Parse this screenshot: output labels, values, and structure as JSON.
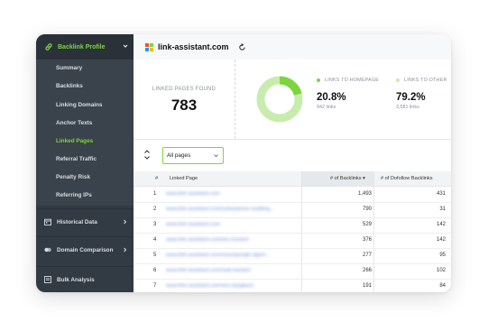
{
  "app": {
    "domain": "link-assistant.com"
  },
  "sidebar": {
    "header": {
      "label": "Backlink Profile"
    },
    "sub_items": [
      {
        "label": "Summary",
        "active": false
      },
      {
        "label": "Backlinks",
        "active": false
      },
      {
        "label": "Linking Domains",
        "active": false
      },
      {
        "label": "Anchor Texts",
        "active": false
      },
      {
        "label": "Linked Pages",
        "active": true
      },
      {
        "label": "Referral Traffic",
        "active": false
      },
      {
        "label": "Penalty Risk",
        "active": false
      },
      {
        "label": "Referring IPs",
        "active": false
      }
    ],
    "sections": [
      {
        "label": "Historical Data",
        "icon": "calendar-icon",
        "arrow": true
      },
      {
        "label": "Domain Comparison",
        "icon": "circles-icon",
        "arrow": true
      },
      {
        "label": "Bulk Analysis",
        "icon": "list-icon",
        "arrow": false
      }
    ]
  },
  "stats": {
    "found_label": "LINKED PAGES FOUND",
    "found_value": "783",
    "homepage": {
      "label": "LINKS TO HOMEPAGE",
      "percent": "20.8%",
      "links": "942 links",
      "fraction": 0.208
    },
    "other": {
      "label": "LINKS TO OTHER",
      "percent": "79.2%",
      "links": "3,581 links"
    }
  },
  "colors": {
    "accent": "#7bd63d",
    "accent_light": "#c8ecae",
    "sidebar": "#323a43"
  },
  "filter": {
    "selected": "All pages"
  },
  "table": {
    "headers": {
      "index": "#",
      "page": "Linked Page",
      "backlinks": "# of Backlinks",
      "dofollow": "# of Dofollow Backlinks"
    },
    "rows": [
      {
        "index": "1",
        "url": "www.link-assistant.com",
        "backlinks": "1,493",
        "dofollow": "431"
      },
      {
        "index": "2",
        "url": "www.link-assistant.com/rankwatcher-building...",
        "backlinks": "790",
        "dofollow": "31"
      },
      {
        "index": "3",
        "url": "www.link-assistant.com",
        "backlinks": "529",
        "dofollow": "142"
      },
      {
        "index": "4",
        "url": "www.link-assistant.com/seo-tracker/",
        "backlinks": "376",
        "dofollow": "142"
      },
      {
        "index": "5",
        "url": "www.link-assistant.com/news/google-algori...",
        "backlinks": "277",
        "dofollow": "95"
      },
      {
        "index": "6",
        "url": "www.link-assistant.com/rank-tracker/",
        "backlinks": "266",
        "dofollow": "102"
      },
      {
        "index": "7",
        "url": "www.link-assistant.com/seo-spyglass/",
        "backlinks": "191",
        "dofollow": "84"
      }
    ]
  }
}
